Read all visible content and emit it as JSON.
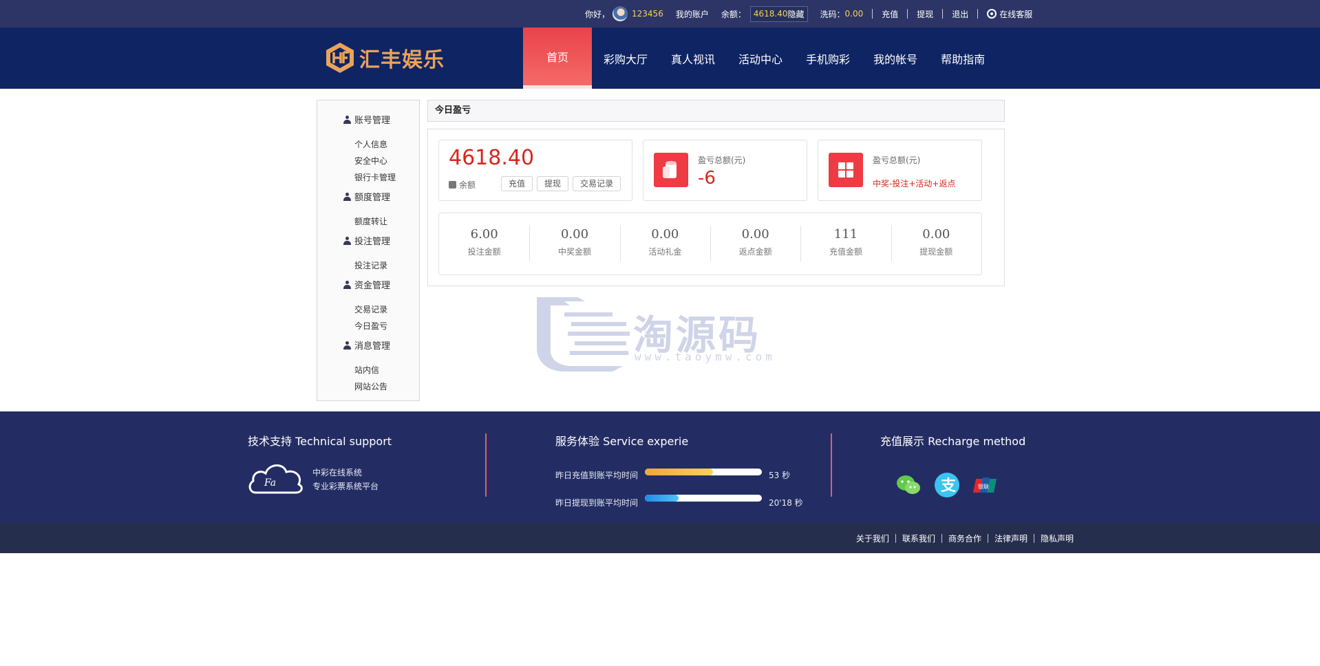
{
  "topbar": {
    "greeting": "你好，",
    "username": "123456",
    "my_account": "我的账户",
    "balance_label": "余额：",
    "balance_value": "4618.40",
    "hide_label": "隐藏",
    "wash_label": "洗码：",
    "wash_value": "0.00",
    "recharge": "充值",
    "withdraw": "提现",
    "logout": "退出",
    "online_service": "在线客服"
  },
  "brand": {
    "name": "汇丰娱乐",
    "accent": "#e9a35b"
  },
  "nav": [
    "首页",
    "彩购大厅",
    "真人视讯",
    "活动中心",
    "手机购彩",
    "我的帐号",
    "帮助指南"
  ],
  "sidebar": {
    "groups": [
      {
        "title": "账号管理",
        "items": [
          "个人信息",
          "安全中心",
          "银行卡管理"
        ]
      },
      {
        "title": "额度管理",
        "items": [
          "额度转让"
        ]
      },
      {
        "title": "投注管理",
        "items": [
          "投注记录"
        ]
      },
      {
        "title": "资金管理",
        "items": [
          "交易记录",
          "今日盈亏"
        ]
      },
      {
        "title": "消息管理",
        "items": [
          "站内信",
          "网站公告"
        ]
      }
    ]
  },
  "main": {
    "title": "今日盈亏",
    "balance": {
      "amount": "4618.40",
      "label": "余额",
      "buttons": [
        "充值",
        "提现",
        "交易记录"
      ]
    },
    "profit": {
      "label": "盈亏总额(元)",
      "value": "-6"
    },
    "formula": {
      "label": "盈亏总额(元)",
      "value": "中奖-投注+活动+返点"
    },
    "stats": [
      {
        "value": "6.00",
        "label": "投注金额"
      },
      {
        "value": "0.00",
        "label": "中奖金额"
      },
      {
        "value": "0.00",
        "label": "活动礼金"
      },
      {
        "value": "0.00",
        "label": "返点金额"
      },
      {
        "value": "111",
        "label": "充值金额"
      },
      {
        "value": "0.00",
        "label": "提现金额"
      }
    ]
  },
  "watermark": {
    "text": "淘源码",
    "url": "www.taoymw.com"
  },
  "footer": {
    "support_title": "技术支持 Technical support",
    "support_line1": "中彩在线系统",
    "support_line2": "专业彩票系统平台",
    "service_title": "服务体验 Service experie",
    "recharge_time_label": "昨日充值到账平均时间",
    "recharge_time_value": "53 秒",
    "recharge_progress": 0.58,
    "withdraw_time_label": "昨日提现到账平均时间",
    "withdraw_time_value": "20'18 秒",
    "withdraw_progress": 0.29,
    "recharge_method_title": "充值展示 Recharge method",
    "bottom_links": [
      "关于我们",
      "联系我们",
      "商务合作",
      "法律声明",
      "隐私声明"
    ]
  }
}
